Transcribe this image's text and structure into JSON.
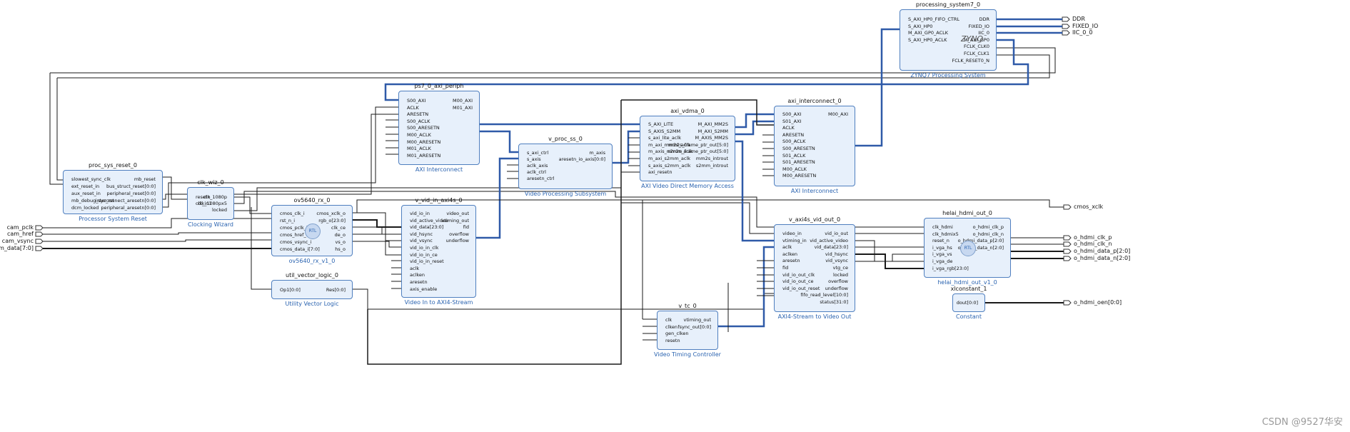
{
  "external_ports": {
    "inputs": [
      "cam_pclk",
      "cam_href",
      "cam_vsync",
      "cam_data[7:0]"
    ],
    "outputs_top": [
      "DDR",
      "FIXED_IO",
      "IIC_0_0"
    ],
    "outputs_right": [
      "cmos_xclk",
      "o_hdmi_clk_p",
      "o_hdmi_clk_n",
      "o_hdmi_data_p[2:0]",
      "o_hdmi_data_n[2:0]",
      "o_hdmi_oen[0:0]"
    ]
  },
  "blocks": {
    "proc_sys_reset": {
      "instance": "proc_sys_reset_0",
      "label": "Processor System Reset",
      "left_pins": [
        "slowest_sync_clk",
        "ext_reset_in",
        "aux_reset_in",
        "mb_debug_sys_rst",
        "dcm_locked"
      ],
      "right_pins": [
        "mb_reset",
        "bus_struct_reset[0:0]",
        "peripheral_reset[0:0]",
        "interconnect_aresetn[0:0]",
        "peripheral_aresetn[0:0]"
      ]
    },
    "clk_wiz": {
      "instance": "clk_wiz_0",
      "label": "Clocking Wizard",
      "left_pins": [
        "resetn",
        "clk_in1"
      ],
      "right_pins": [
        "clk_1080p",
        "clk_1080px5",
        "locked"
      ]
    },
    "ov5640": {
      "instance": "ov5640_rx_0",
      "label": "ov5640_rx_v1_0",
      "badge": "RTL",
      "left_pins": [
        "cmos_clk_i",
        "rst_n_i",
        "cmos_pclk_i",
        "cmos_href_i",
        "cmos_vsync_i",
        "cmos_data_i[7:0]"
      ],
      "right_pins": [
        "cmos_xclk_o",
        "rgb_o[23:0]",
        "clk_ce",
        "de_o",
        "vs_o",
        "hs_o"
      ]
    },
    "util_vector_logic": {
      "instance": "util_vector_logic_0",
      "label": "Utility Vector Logic",
      "left_pins": [
        "Op1[0:0]"
      ],
      "right_pins": [
        "Res[0:0]"
      ]
    },
    "axi_periph": {
      "instance": "ps7_0_axi_periph",
      "label": "AXI Interconnect",
      "left_pins": [
        "S00_AXI",
        "ACLK",
        "ARESETN",
        "S00_ACLK",
        "S00_ARESETN",
        "M00_ACLK",
        "M00_ARESETN",
        "M01_ACLK",
        "M01_ARESETN"
      ],
      "right_pins": [
        "M00_AXI",
        "M01_AXI"
      ]
    },
    "vid_in": {
      "instance": "v_vid_in_axi4s_0",
      "label": "Video In to AXI4-Stream",
      "left_pins": [
        "vid_io_in",
        "vid_active_video",
        "vid_data[23:0]",
        "vid_hsync",
        "vid_vsync",
        "vid_io_in_clk",
        "vid_io_in_ce",
        "vid_io_in_reset",
        "aclk",
        "aclken",
        "aresetn",
        "axis_enable"
      ],
      "right_pins": [
        "video_out",
        "vtiming_out",
        "fid",
        "overflow",
        "underflow"
      ]
    },
    "proc_ss": {
      "instance": "v_proc_ss_0",
      "label": "Video Processing Subsystem",
      "left_pins": [
        "s_axi_ctrl",
        "s_axis",
        "aclk_axis",
        "aclk_ctrl",
        "aresetn_ctrl"
      ],
      "right_pins": [
        "m_axis",
        "aresetn_io_axis[0:0]"
      ]
    },
    "vdma": {
      "instance": "axi_vdma_0",
      "label": "AXI Video Direct Memory Access",
      "left_pins": [
        "S_AXI_LITE",
        "S_AXIS_S2MM",
        "s_axi_lite_aclk",
        "m_axi_mm2s_aclk",
        "m_axis_mm2s_aclk",
        "m_axi_s2mm_aclk",
        "s_axis_s2mm_aclk",
        "axi_resetn"
      ],
      "right_pins": [
        "M_AXI_MM2S",
        "M_AXI_S2MM",
        "M_AXIS_MM2S",
        "mm2s_frame_ptr_out[5:0]",
        "s2mm_frame_ptr_out[5:0]",
        "mm2s_introut",
        "s2mm_introut"
      ]
    },
    "interconnect": {
      "instance": "axi_interconnect_0",
      "label": "AXI Interconnect",
      "left_pins": [
        "S00_AXI",
        "S01_AXI",
        "ACLK",
        "ARESETN",
        "S00_ACLK",
        "S00_ARESETN",
        "S01_ACLK",
        "S01_ARESETN",
        "M00_ACLK",
        "M00_ARESETN"
      ],
      "right_pins": [
        "M00_AXI"
      ]
    },
    "ps7": {
      "instance": "processing_system7_0",
      "label": "ZYNQ7 Processing System",
      "logo": "ZYNQ",
      "left_pins": [
        "S_AXI_HP0_FIFO_CTRL",
        "S_AXI_HP0",
        "M_AXI_GP0_ACLK",
        "S_AXI_HP0_ACLK"
      ],
      "right_pins": [
        "DDR",
        "FIXED_IO",
        "IIC_0",
        "M_AXI_GP0",
        "FCLK_CLK0",
        "FCLK_CLK1",
        "FCLK_RESET0_N"
      ]
    },
    "vid_out": {
      "instance": "v_axi4s_vid_out_0",
      "label": "AXI4-Stream to Video Out",
      "left_pins": [
        "video_in",
        "vtiming_in",
        "aclk",
        "aclken",
        "aresetn",
        "fid",
        "vid_io_out_clk",
        "vid_io_out_ce",
        "vid_io_out_reset"
      ],
      "right_pins": [
        "vid_io_out",
        "vid_active_video",
        "vid_data[23:0]",
        "vid_hsync",
        "vid_vsync",
        "vtg_ce",
        "locked",
        "overflow",
        "underflow",
        "fifo_read_level[10:0]",
        "status[31:0]"
      ]
    },
    "vtc": {
      "instance": "v_tc_0",
      "label": "Video Timing Controller",
      "left_pins": [
        "clk",
        "clken",
        "gen_clken",
        "resetn"
      ],
      "right_pins": [
        "vtiming_out",
        "fsync_out[0:0]"
      ]
    },
    "hdmi": {
      "instance": "helai_hdmi_out_0",
      "label": "helai_hdmi_out_v1_0",
      "badge": "RTL",
      "left_pins": [
        "clk_hdmi",
        "clk_hdmix5",
        "reset_n",
        "i_vga_hs",
        "i_vga_vs",
        "i_vga_de",
        "i_vga_rgb[23:0]"
      ],
      "right_pins": [
        "o_hdmi_clk_p",
        "o_hdmi_clk_n",
        "o_hdmi_data_p[2:0]",
        "o_hdmi_data_n[2:0]"
      ]
    },
    "xlconstant": {
      "instance": "xlconstant_1",
      "label": "Constant",
      "left_pins": [],
      "right_pins": [
        "dout[0:0]"
      ]
    }
  },
  "watermark": "CSDN @9527华安"
}
